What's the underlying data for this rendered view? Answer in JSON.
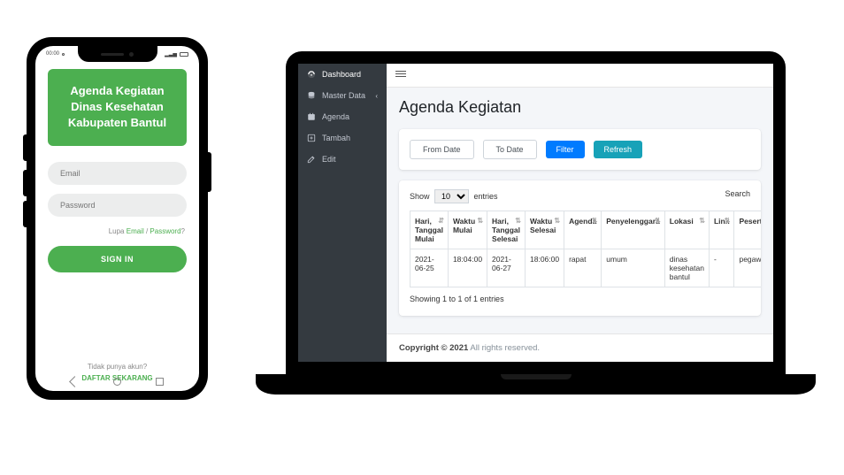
{
  "phone": {
    "status": {
      "time": "00:00",
      "signal": "▂▃▅",
      "batt": "80"
    },
    "header_line1": "Agenda Kegiatan",
    "header_line2": "Dinas Kesehatan",
    "header_line3": "Kabupaten Bantul",
    "email_placeholder": "Email",
    "password_placeholder": "Password",
    "forgot_prefix": "Lupa ",
    "forgot_email": "Email",
    "forgot_sep": " / ",
    "forgot_pw": "Password",
    "forgot_q": "?",
    "signin_label": "SIGN IN",
    "noaccount": "Tidak punya akun?",
    "daftar": "DAFTAR SEKARANG"
  },
  "laptop": {
    "sidebar": {
      "items": [
        {
          "icon": "dashboard",
          "label": "Dashboard"
        },
        {
          "icon": "database",
          "label": "Master Data",
          "chev": "‹"
        },
        {
          "icon": "calendar",
          "label": "Agenda"
        },
        {
          "icon": "plus",
          "label": "Tambah"
        },
        {
          "icon": "edit",
          "label": "Edit"
        }
      ]
    },
    "page_title": "Agenda Kegiatan",
    "filters": {
      "from": "From Date",
      "to": "To Date",
      "filter": "Filter",
      "refresh": "Refresh"
    },
    "dt": {
      "show": "Show",
      "len": "10",
      "entries_suffix": "entries",
      "search_label": "Search"
    },
    "table": {
      "headers": [
        "Hari, Tanggal Mulai",
        "Waktu Mulai",
        "Hari, Tanggal Selesai",
        "Waktu Selesai",
        "Agenda",
        "Penyelenggara",
        "Lokasi",
        "Link",
        "Peserta"
      ],
      "rows": [
        [
          "2021-06-25",
          "18:04:00",
          "2021-06-27",
          "18:06:00",
          "rapat",
          "umum",
          "dinas kesehatan bantul",
          "-",
          "pegawai"
        ]
      ],
      "info": "Showing 1 to 1 of 1 entries"
    },
    "footer": {
      "bold": "Copyright © 2021",
      "rest": " All rights reserved."
    }
  }
}
